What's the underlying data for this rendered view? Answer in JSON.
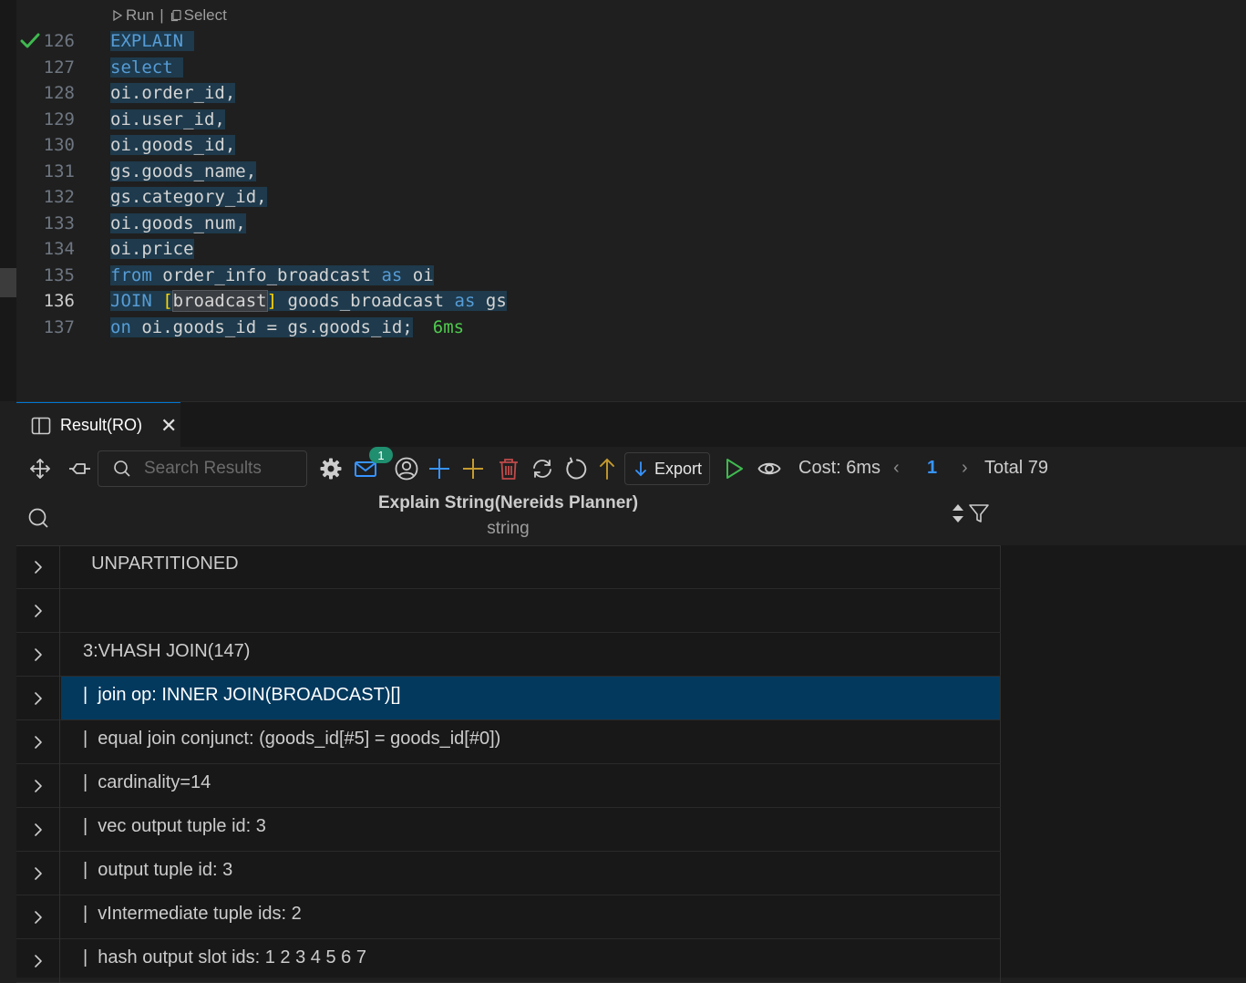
{
  "codelens": {
    "run": "Run",
    "separator": "|",
    "select": "Select"
  },
  "editor": {
    "lines": [
      {
        "num": "126",
        "tokens": [
          {
            "t": "EXPLAIN",
            "c": "kw"
          }
        ],
        "check": true
      },
      {
        "num": "127",
        "tokens": [
          {
            "t": "select",
            "c": "kw"
          }
        ]
      },
      {
        "num": "128",
        "tokens": [
          {
            "t": "oi.order_id,",
            "c": "txt"
          }
        ]
      },
      {
        "num": "129",
        "tokens": [
          {
            "t": "oi.user_id,",
            "c": "txt"
          }
        ]
      },
      {
        "num": "130",
        "tokens": [
          {
            "t": "oi.goods_id,",
            "c": "txt"
          }
        ]
      },
      {
        "num": "131",
        "tokens": [
          {
            "t": "gs.goods_name,",
            "c": "txt"
          }
        ]
      },
      {
        "num": "132",
        "tokens": [
          {
            "t": "gs.category_id,",
            "c": "txt"
          }
        ]
      },
      {
        "num": "133",
        "tokens": [
          {
            "t": "oi.goods_num,",
            "c": "txt"
          }
        ]
      },
      {
        "num": "134",
        "tokens": [
          {
            "t": "oi.price",
            "c": "txt"
          }
        ]
      },
      {
        "num": "135",
        "tokens": [
          {
            "t": "from",
            "c": "kw"
          },
          {
            "t": " order_info_broadcast ",
            "c": "txt"
          },
          {
            "t": "as",
            "c": "kw"
          },
          {
            "t": " oi",
            "c": "txt"
          }
        ]
      },
      {
        "num": "136",
        "active": true,
        "tokens": [
          {
            "t": "JOIN",
            "c": "kw"
          },
          {
            "t": " ",
            "c": "txt"
          },
          {
            "t": "[",
            "c": "brk"
          },
          {
            "t": "broadcast",
            "c": "txt bl"
          },
          {
            "t": "]",
            "c": "brk"
          },
          {
            "t": " goods_broadcast ",
            "c": "txt"
          },
          {
            "t": "as",
            "c": "kw"
          },
          {
            "t": " gs",
            "c": "txt"
          }
        ]
      },
      {
        "num": "137",
        "tokens": [
          {
            "t": "on",
            "c": "kw"
          },
          {
            "t": " oi.goods_id = gs.goods_id;",
            "c": "txt"
          }
        ],
        "timing": "6ms"
      }
    ]
  },
  "panel": {
    "tab_label": "Result(RO)",
    "tab_close": "✕",
    "search_placeholder": "Search Results",
    "notification_count": "1",
    "export_label": "Export",
    "cost_label": "Cost: 6ms",
    "page_prev": "‹",
    "page_current": "1",
    "page_next": "›",
    "total_label": "Total 79"
  },
  "colors": {
    "accent": "#0078d4",
    "selected_row": "#04395e",
    "keyword": "#569cd6",
    "run": "#3fb950"
  },
  "table": {
    "column_title": "Explain String(Nereids Planner)",
    "column_type": "string",
    "rows": [
      "  UNPARTITIONED",
      "",
      "3:VHASH JOIN(147)",
      "|  join op: INNER JOIN(BROADCAST)[]",
      "|  equal join conjunct: (goods_id[#5] = goods_id[#0])",
      "|  cardinality=14",
      "|  vec output tuple id: 3",
      "|  output tuple id: 3",
      "|  vIntermediate tuple ids: 2",
      "|  hash output slot ids: 1 2 3 4 5 6 7"
    ],
    "selected_index": 3
  }
}
